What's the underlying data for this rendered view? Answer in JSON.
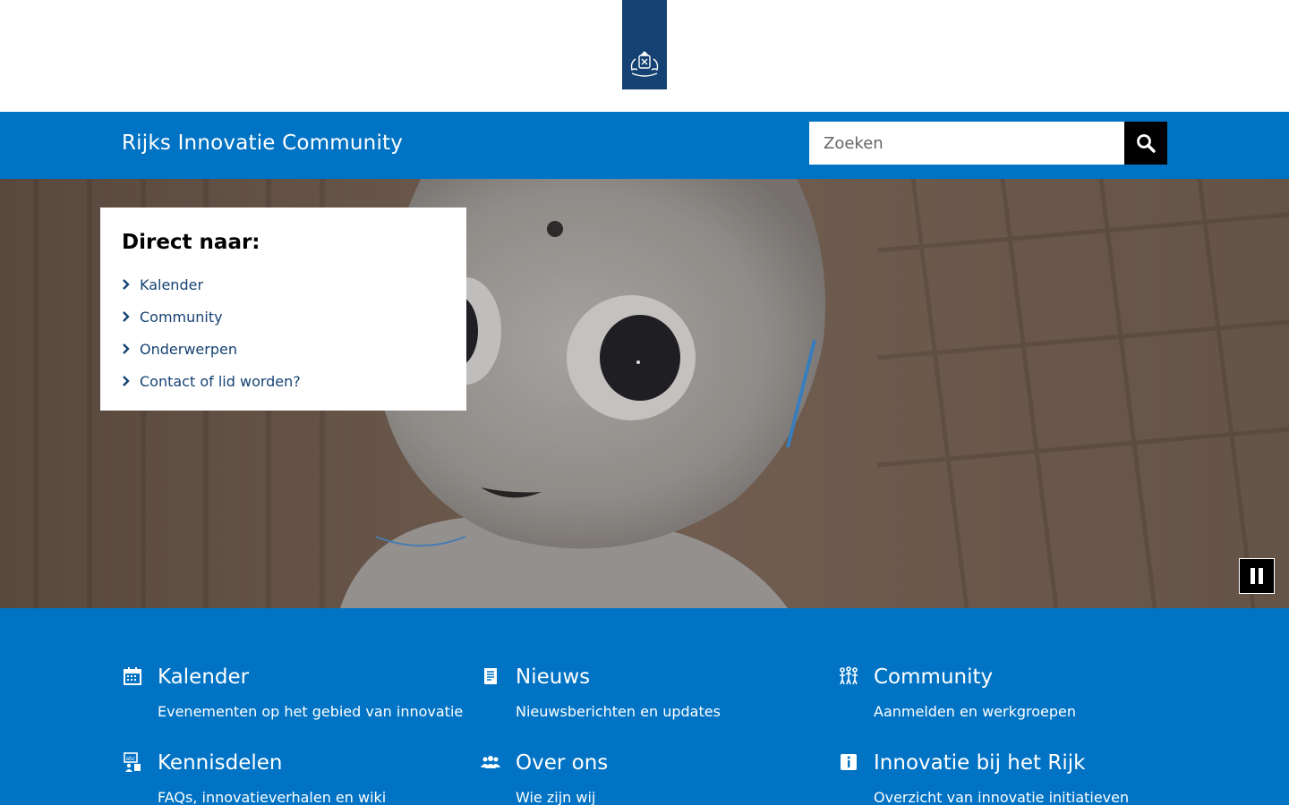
{
  "header": {
    "logo_icon": "coat-of-arms-icon",
    "colors": {
      "ribbon": "#154273",
      "topbar": "#0073c4"
    }
  },
  "topbar": {
    "site_title": "Rijks Innovatie Community",
    "search_placeholder": "Zoeken",
    "search_value": ""
  },
  "hero": {
    "image": "robot-face-photo",
    "direct_title": "Direct naar:",
    "links": [
      {
        "label": "Kalender"
      },
      {
        "label": "Community"
      },
      {
        "label": "Onderwerpen"
      },
      {
        "label": "Contact of lid worden?"
      }
    ],
    "pause_icon": "pause-icon"
  },
  "tiles": [
    {
      "icon": "calendar-icon",
      "title": "Kalender",
      "subtitle": "Evenementen op het gebied van innovatie"
    },
    {
      "icon": "newspaper-icon",
      "title": "Nieuws",
      "subtitle": "Nieuwsberichten en updates"
    },
    {
      "icon": "community-icon",
      "title": "Community",
      "subtitle": "Aanmelden en werkgroepen"
    },
    {
      "icon": "knowledge-share-icon",
      "title": "Kennisdelen",
      "subtitle": "FAQs, innovatieverhalen en wiki"
    },
    {
      "icon": "group-icon",
      "title": "Over ons",
      "subtitle": "Wie zijn wij"
    },
    {
      "icon": "info-icon",
      "title": "Innovatie bij het Rijk",
      "subtitle": "Overzicht van innovatie initiatieven"
    }
  ]
}
